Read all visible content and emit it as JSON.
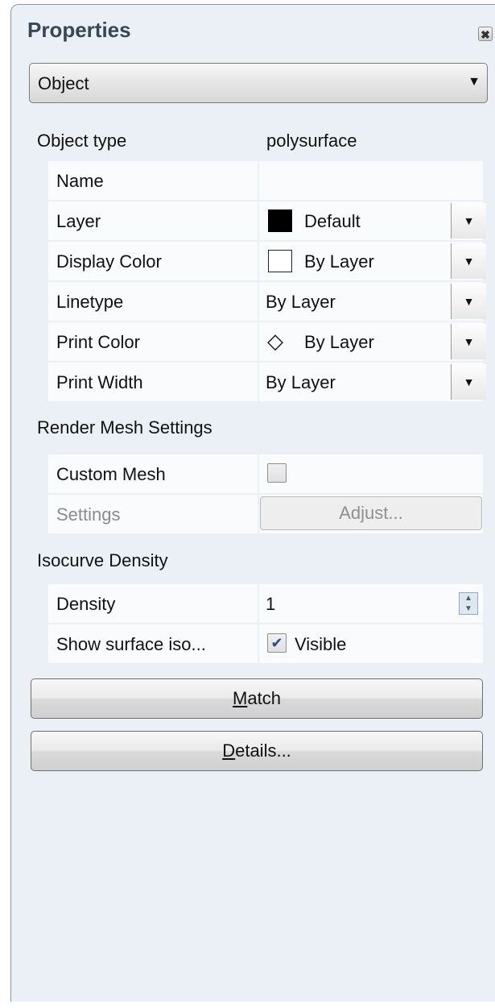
{
  "window": {
    "title": "Properties",
    "close_icon": "✖"
  },
  "object_dropdown": {
    "value": "Object"
  },
  "object_type": {
    "label": "Object type",
    "value": "polysurface"
  },
  "properties": {
    "name": {
      "label": "Name",
      "value": ""
    },
    "layer": {
      "label": "Layer",
      "value": "Default",
      "swatch_color": "#000000"
    },
    "display_color": {
      "label": "Display Color",
      "value": "By Layer",
      "swatch_color": "#ffffff"
    },
    "linetype": {
      "label": "Linetype",
      "value": "By Layer"
    },
    "print_color": {
      "label": "Print Color",
      "value": "By Layer",
      "icon": "◇"
    },
    "print_width": {
      "label": "Print Width",
      "value": "By Layer"
    }
  },
  "render_mesh": {
    "section_label": "Render Mesh Settings",
    "custom_mesh": {
      "label": "Custom Mesh",
      "checked": false
    },
    "settings": {
      "label": "Settings",
      "button": "Adjust..."
    }
  },
  "isocurve": {
    "section_label": "Isocurve Density",
    "density": {
      "label": "Density",
      "value": "1"
    },
    "show_iso": {
      "label": "Show surface iso...",
      "value": "Visible",
      "checked": true
    }
  },
  "buttons": {
    "match": {
      "mnemonic": "M",
      "rest": "atch"
    },
    "details": {
      "mnemonic": "D",
      "rest": "etails..."
    }
  }
}
